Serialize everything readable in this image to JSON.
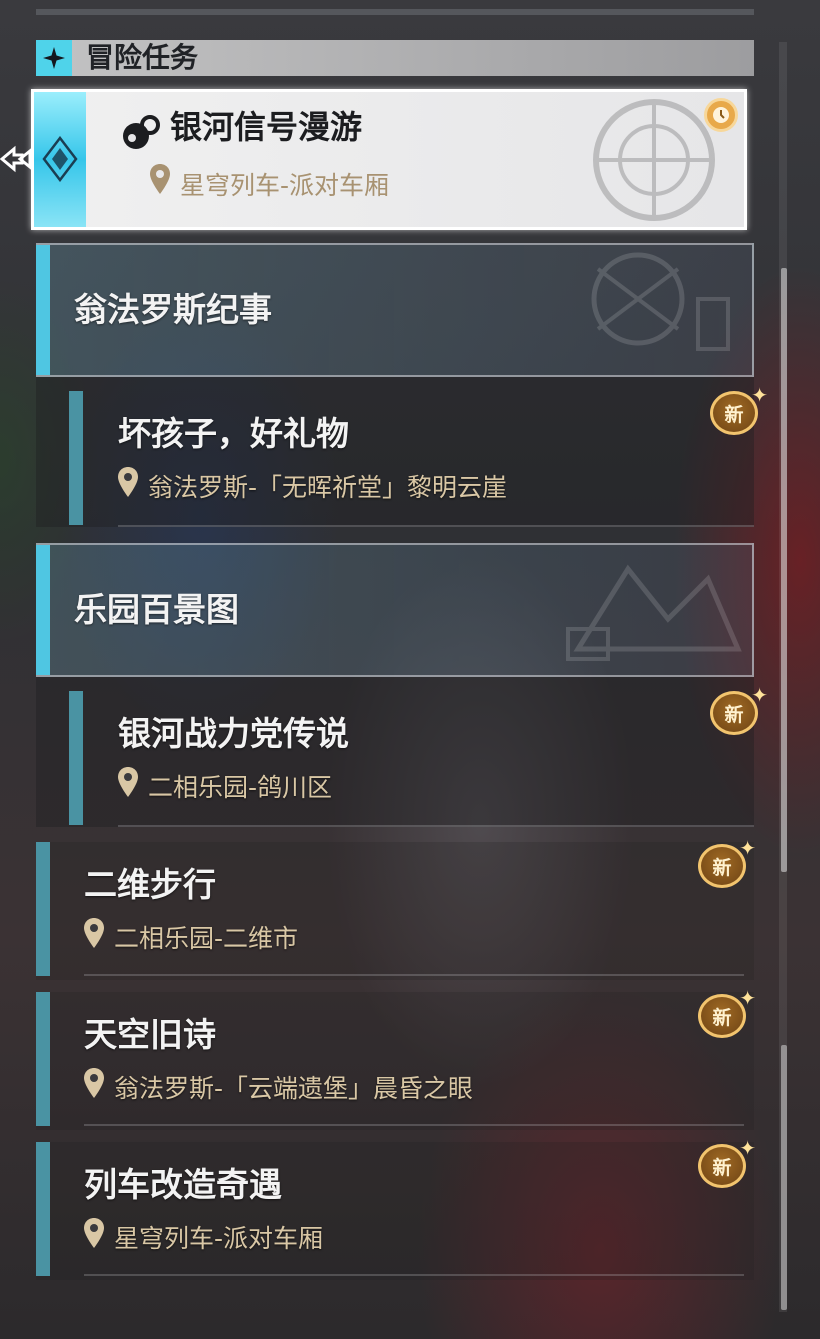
{
  "section": {
    "title": "冒险任务"
  },
  "selected_quest": {
    "title": "银河信号漫游",
    "location": "星穹列车-派对车厢",
    "icon": "quest-type-icon",
    "tracking_icon": "clock-icon"
  },
  "groups": [
    {
      "title": "翁法罗斯纪事"
    },
    {
      "title": "乐园百景图"
    }
  ],
  "quests": [
    {
      "title": "坏孩子，好礼物",
      "location": "翁法罗斯-「无晖祈堂」黎明云崖",
      "badge": "新"
    },
    {
      "title": "银河战力党传说",
      "location": "二相乐园-鸽川区",
      "badge": "新"
    },
    {
      "title": "二维步行",
      "location": "二相乐园-二维市",
      "badge": "新"
    },
    {
      "title": "天空旧诗",
      "location": "翁法罗斯-「云端遗堡」晨昏之眼",
      "badge": "新"
    },
    {
      "title": "列车改造奇遇",
      "location": "星穹列车-派对车厢",
      "badge": "新"
    }
  ],
  "colors": {
    "accent_cyan": "#4fc6e2",
    "location_gold": "#d9c7a5",
    "badge_gold": "#f2c46e"
  }
}
